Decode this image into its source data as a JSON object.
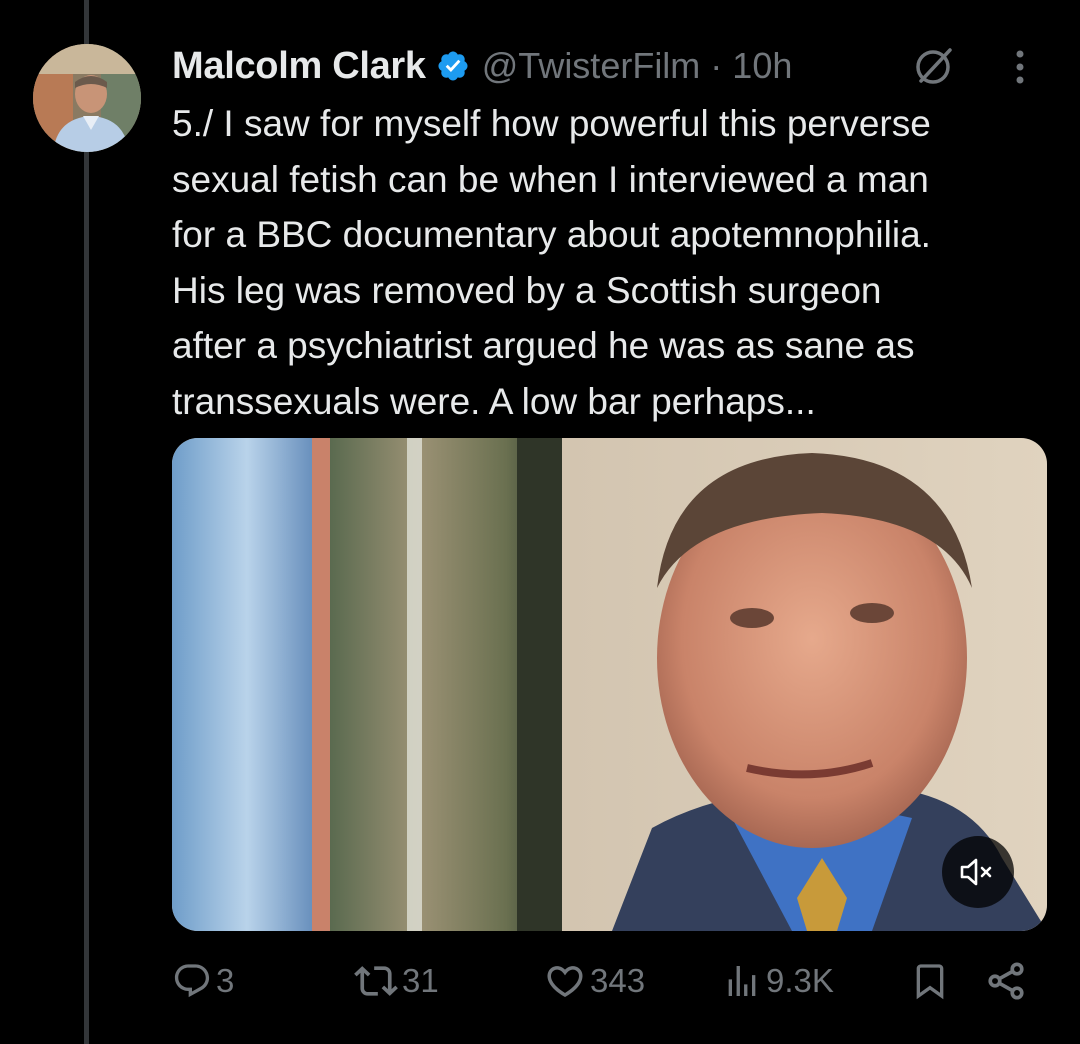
{
  "author": {
    "name": "Malcolm Clark",
    "handle": "@TwisterFilm",
    "separator": "·",
    "time": "10h",
    "verified_color": "#1d9bf0"
  },
  "tweet": {
    "text": "5./ I saw for myself how powerful this perverse\nsexual fetish can be when I interviewed a man\nfor a BBC documentary about apotemnophilia.\nHis leg was removed by a Scottish surgeon\nafter a psychiatrist argued he was as sane as\ntranssexuals were. A low bar perhaps..."
  },
  "media": {
    "type": "video",
    "muted": true
  },
  "actions": {
    "replies": "3",
    "reposts": "31",
    "likes": "343",
    "views": "9.3K"
  },
  "icons": {
    "grok": "grok-icon",
    "more": "more-icon",
    "reply": "reply-icon",
    "repost": "repost-icon",
    "like": "heart-icon",
    "views": "views-icon",
    "bookmark": "bookmark-icon",
    "share": "share-icon",
    "mute": "muted-speaker-icon"
  },
  "colors": {
    "background": "#000000",
    "text": "#e7e9ea",
    "secondary": "#71767b",
    "accent": "#1d9bf0"
  }
}
